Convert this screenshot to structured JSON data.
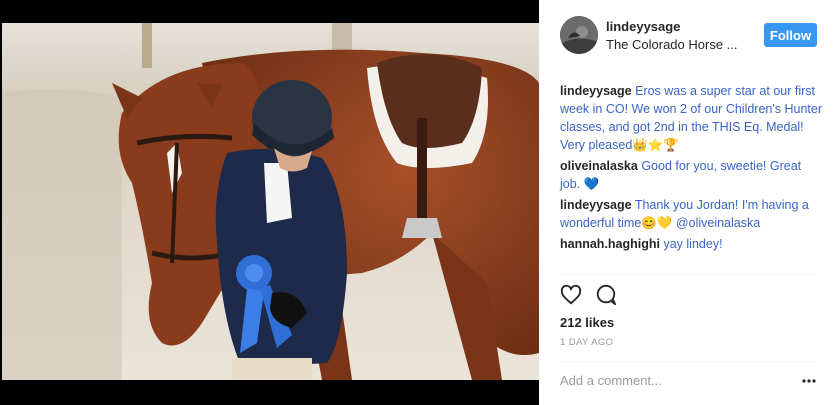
{
  "post": {
    "username": "lindeyysage",
    "location": "The Colorado Horse ...",
    "follow_label": "Follow",
    "likes": "212 likes",
    "time": "1 DAY AGO",
    "comment_placeholder": "Add a comment..."
  },
  "comments": [
    {
      "user": "lindeyysage",
      "text": "Eros was a super star at our first week in CO! We won 2 of our Children's Hunter classes, and got 2nd in the THIS Eq. Medal! Very pleased",
      "emoji": "👑⭐🏆"
    },
    {
      "user": "oliveinalaska",
      "text": "Good for you, sweetie! Great job.",
      "emoji": "💙"
    },
    {
      "user": "lindeyysage",
      "text": "Thank you Jordan! I'm having a wonderful time",
      "emoji": "😊💛",
      "mention": "@oliveinalaska"
    },
    {
      "user": "hannah.haghighi",
      "text": "yay lindey!"
    }
  ],
  "icons": {
    "like": "heart-icon",
    "comment": "comment-bubble-icon",
    "more": "more-options-icon"
  },
  "colors": {
    "follow_button": "#3897f0",
    "comment_text": "#3a64c4"
  }
}
